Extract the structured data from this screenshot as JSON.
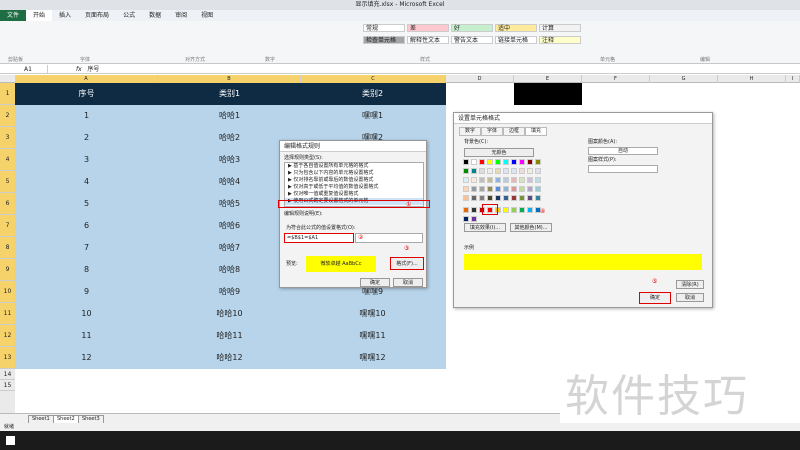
{
  "window": {
    "title": "显示填充.xlsx - Microsoft Excel"
  },
  "tabs": [
    "文件",
    "开始",
    "插入",
    "页面布局",
    "公式",
    "数据",
    "审阅",
    "视图"
  ],
  "ribbon": {
    "styles": [
      {
        "l": "常规",
        "c": "#ffffff"
      },
      {
        "l": "差",
        "c": "#ffc7ce"
      },
      {
        "l": "好",
        "c": "#c6efce"
      },
      {
        "l": "适中",
        "c": "#ffeb9c"
      },
      {
        "l": "计算",
        "c": "#f2f2f2"
      },
      {
        "l": "检查单元格",
        "c": "#a5a5a5"
      },
      {
        "l": "解释性文本",
        "c": "#ffffff"
      },
      {
        "l": "警告文本",
        "c": "#ffffff"
      },
      {
        "l": "链接单元格",
        "c": "#ffffff"
      },
      {
        "l": "注释",
        "c": "#ffffcc"
      }
    ],
    "groups": [
      "剪贴板",
      "字体",
      "对齐方式",
      "数字",
      "样式",
      "单元格",
      "编辑"
    ]
  },
  "formula_bar": {
    "name_box": "A1",
    "fx": "fx",
    "content": "序号"
  },
  "columns": [
    "A",
    "B",
    "C",
    "D",
    "E",
    "F",
    "G",
    "H",
    "I"
  ],
  "rows": [
    "1",
    "2",
    "3",
    "4",
    "5",
    "6",
    "7",
    "8",
    "9",
    "10",
    "11",
    "12",
    "13",
    "14",
    "15"
  ],
  "table": {
    "headers": [
      "序号",
      "类别1",
      "类别2"
    ],
    "rows": [
      [
        "1",
        "哈哈1",
        "嘿嘿1"
      ],
      [
        "2",
        "哈哈2",
        "嘿嘿2"
      ],
      [
        "3",
        "哈哈3",
        "嘿嘿3"
      ],
      [
        "4",
        "哈哈4",
        "嘿嘿4"
      ],
      [
        "5",
        "哈哈5",
        "嘿嘿5"
      ],
      [
        "6",
        "哈哈6",
        "嘿嘿6"
      ],
      [
        "7",
        "哈哈7",
        "嘿嘿7"
      ],
      [
        "8",
        "哈哈8",
        "嘿嘿8"
      ],
      [
        "9",
        "哈哈9",
        "嘿嘿9"
      ],
      [
        "10",
        "哈哈10",
        "嘿嘿10"
      ],
      [
        "11",
        "哈哈11",
        "嘿嘿11"
      ],
      [
        "12",
        "哈哈12",
        "嘿嘿12"
      ]
    ]
  },
  "dlg1": {
    "title": "编辑格式规则",
    "type_label": "选择规则类型(S):",
    "rules": [
      "▶ 基于各自值设置所有单元格的格式",
      "▶ 只为包含以下内容的单元格设置格式",
      "▶ 仅对排名靠前或靠后的数值设置格式",
      "▶ 仅对高于或低于平均值的数值设置格式",
      "▶ 仅对唯一值或重复值设置格式",
      "▶ 使用公式确定要设置格式的单元格"
    ],
    "desc_label": "编辑规则说明(E):",
    "formula_label": "为符合此公式的值设置格式(O):",
    "formula": "=$B$1=$A1",
    "preview_label": "预览:",
    "preview_text": "微软卓越  AaBbCc",
    "format_btn": "格式(F)...",
    "ok": "确定",
    "cancel": "取消",
    "n1": "①",
    "n2": "②",
    "n3": "③"
  },
  "dlg2": {
    "title": "设置单元格格式",
    "tabs": [
      "数字",
      "字体",
      "边框",
      "填充"
    ],
    "bg_label": "背景色(C):",
    "no_color": "无颜色",
    "pattern_color_label": "图案颜色(A):",
    "pattern_color": "自动",
    "pattern_style_label": "图案样式(P):",
    "fill_effects": "填充效果(I)...",
    "more_colors": "其他颜色(M)...",
    "sample_label": "示例",
    "sample_color": "#ffff00",
    "clear": "清除(R)",
    "ok": "确定",
    "cancel": "取消",
    "n4": "④",
    "n5": "⑤"
  },
  "sheets": [
    "Sheet1",
    "Sheet2",
    "Sheet3"
  ],
  "status": "就绪",
  "watermark": "软件技巧"
}
